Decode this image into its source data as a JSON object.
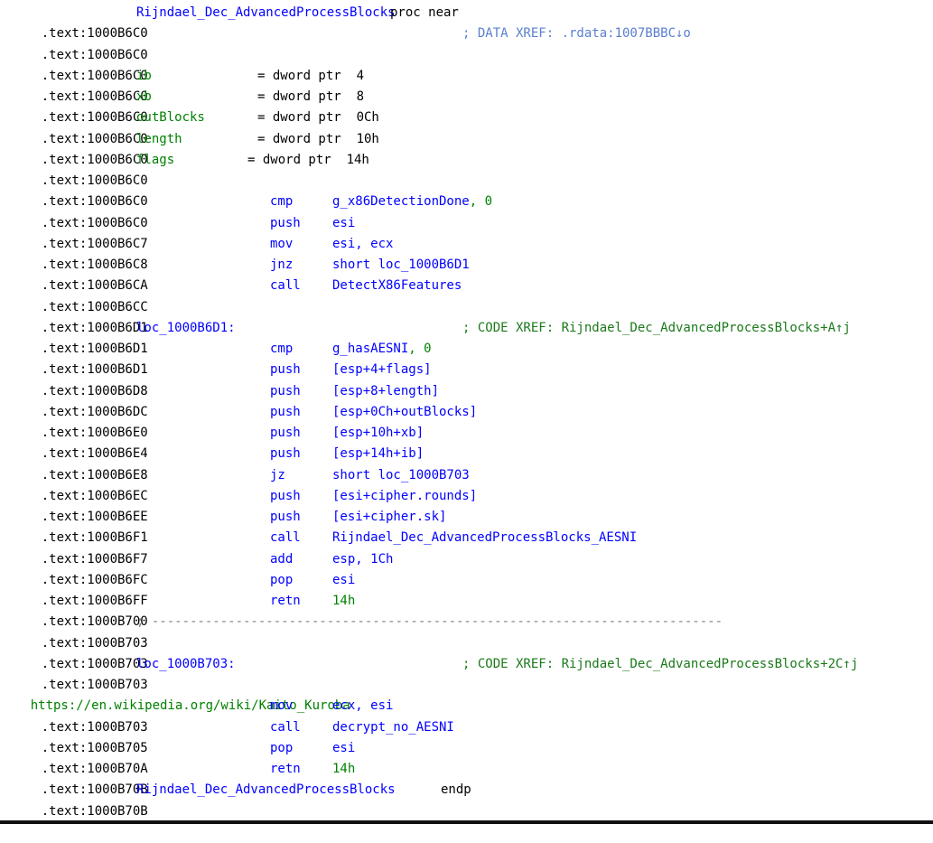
{
  "lines": [
    {
      "addr": ".text:1000B6C0",
      "proc_name": "Rijndael_Dec_AdvancedProcessBlocks",
      "proc_kw": "proc near"
    },
    {
      "addr": ".text:1000B6C0",
      "comment": "; DATA XREF: .rdata:1007BBBC↓o"
    },
    {
      "addr": ".text:1000B6C0"
    },
    {
      "addr": ".text:1000B6C0",
      "var": "ib",
      "def": "= dword ptr  4"
    },
    {
      "addr": ".text:1000B6C0",
      "var": "xb",
      "def": "= dword ptr  8"
    },
    {
      "addr": ".text:1000B6C0",
      "var": "outBlocks",
      "def": "= dword ptr  0Ch"
    },
    {
      "addr": ".text:1000B6C0",
      "var": "length",
      "def": "= dword ptr  10h"
    },
    {
      "addr": ".text:1000B6C0",
      "var": "flags",
      "def": "= dword ptr  14h"
    },
    {
      "addr": ".text:1000B6C0"
    },
    {
      "addr": ".text:1000B6C0",
      "mnem": "cmp",
      "op1": "g_x86DetectionDone",
      "op2": ", 0"
    },
    {
      "addr": ".text:1000B6C7",
      "mnem": "push",
      "op1": "esi"
    },
    {
      "addr": ".text:1000B6C8",
      "mnem": "mov",
      "op1": "esi, ecx"
    },
    {
      "addr": ".text:1000B6CA",
      "mnem": "jnz",
      "op1": "short loc_1000B6D1"
    },
    {
      "addr": ".text:1000B6CC",
      "mnem": "call",
      "op1": "DetectX86Features"
    },
    {
      "addr": ".text:1000B6D1"
    },
    {
      "addr": ".text:1000B6D1",
      "label": "loc_1000B6D1:",
      "comment": "; CODE XREF: Rijndael_Dec_AdvancedProcessBlocks+A↑j"
    },
    {
      "addr": ".text:1000B6D1",
      "mnem": "cmp",
      "op1": "g_hasAESNI",
      "op2": ", 0"
    },
    {
      "addr": ".text:1000B6D8",
      "mnem": "push",
      "op1": "[esp+4+flags]"
    },
    {
      "addr": ".text:1000B6DC",
      "mnem": "push",
      "op1": "[esp+8+length]"
    },
    {
      "addr": ".text:1000B6E0",
      "mnem": "push",
      "op1": "[esp+0Ch+outBlocks]"
    },
    {
      "addr": ".text:1000B6E4",
      "mnem": "push",
      "op1": "[esp+10h+xb]"
    },
    {
      "addr": ".text:1000B6E8",
      "mnem": "push",
      "op1": "[esp+14h+ib]"
    },
    {
      "addr": ".text:1000B6EC",
      "mnem": "jz",
      "op1": "short loc_1000B703"
    },
    {
      "addr": ".text:1000B6EE",
      "mnem": "push",
      "op1": "[esi+cipher.rounds]"
    },
    {
      "addr": ".text:1000B6F1",
      "mnem": "push",
      "op1": "[esi+cipher.sk]"
    },
    {
      "addr": ".text:1000B6F7",
      "mnem": "call",
      "op1": "Rijndael_Dec_AdvancedProcessBlocks_AESNI"
    },
    {
      "addr": ".text:1000B6FC",
      "mnem": "add",
      "op1": "esp, 1Ch"
    },
    {
      "addr": ".text:1000B6FF",
      "mnem": "pop",
      "op1": "esi"
    },
    {
      "addr": ".text:1000B700",
      "mnem": "retn",
      "op1": "14h"
    },
    {
      "addr": ".text:1000B703",
      "separator": "; ---------------------------------------------------------------------------"
    },
    {
      "addr": ".text:1000B703"
    },
    {
      "addr": ".text:1000B703",
      "label": "loc_1000B703:",
      "comment": "; CODE XREF: Rijndael_Dec_AdvancedProcessBlocks+2C↑j"
    },
    {
      "url": "https://en.wikipedia.org/wiki/Kaito_Kuroba"
    },
    {
      "addr": ".text:1000B703",
      "mnem": "mov",
      "op1": "ecx, esi"
    },
    {
      "addr": ".text:1000B705",
      "mnem": "call",
      "op1": "decrypt_no_AESNI"
    },
    {
      "addr": ".text:1000B70A",
      "mnem": "pop",
      "op1": "esi"
    },
    {
      "addr": ".text:1000B70B",
      "mnem": "retn",
      "op1": "14h"
    },
    {
      "addr": ".text:1000B70B",
      "proc_name": "Rijndael_Dec_AdvancedProcessBlocks",
      "proc_kw": "endp"
    }
  ]
}
